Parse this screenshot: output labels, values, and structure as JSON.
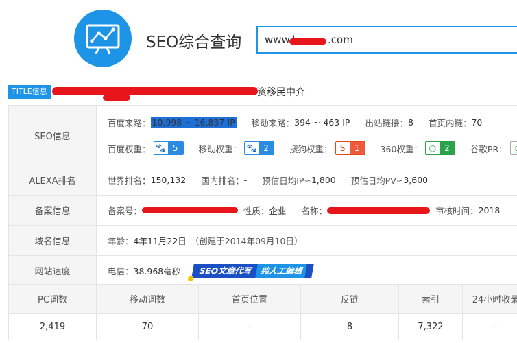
{
  "header": {
    "logo_icon": "chart-monitor-icon",
    "title": "SEO综合查询",
    "search_value": "www.l          .com"
  },
  "title_row": {
    "badge": "TITLE信息",
    "text_suffix": "资移民中介"
  },
  "seo": {
    "label": "SEO信息",
    "baidu_from_label": "百度来路：",
    "baidu_from_value": "10,998 ~ 16,837 IP",
    "mobile_from_label": "移动来路：",
    "mobile_from_value": "394 ~ 463 IP",
    "out_links_label": "出站链接：",
    "out_links_value": "8",
    "home_links_label": "首页内链：",
    "home_links_value": "70",
    "baidu_weight_label": "百度权重：",
    "baidu_weight_value": "5",
    "mobile_weight_label": "移动权重：",
    "mobile_weight_value": "2",
    "sogou_weight_label": "搜狗权重：",
    "sogou_weight_value": "1",
    "s360_weight_label": "360权重：",
    "s360_weight_value": "2",
    "google_pr_label": "谷歌PR："
  },
  "alexa": {
    "label": "ALEXA排名",
    "world_label": "世界排名：",
    "world_value": "150,132",
    "domestic_label": "国内排名：",
    "domestic_value": "-",
    "ip_label": "预估日均IP≈",
    "ip_value": "1,800",
    "pv_label": "预估日均PV≈",
    "pv_value": "3,600"
  },
  "icp": {
    "label": "备案信息",
    "number_label": "备案号：",
    "nature_label": "性质：",
    "nature_value": "企业",
    "name_label": "名称：",
    "review_label": "审核时间：",
    "review_value": "2018-"
  },
  "domain": {
    "label": "域名信息",
    "age_label": "年龄：",
    "age_value": "4年11月22日",
    "created_text": "（创建于2014年09月10日）"
  },
  "speed": {
    "label": "网站速度",
    "telecom_label": "电信：",
    "telecom_value": "38.968毫秒",
    "promo_1": "SEO文章代写",
    "promo_2": "纯人工编辑"
  },
  "stats": {
    "headers": [
      "PC词数",
      "移动词数",
      "首页位置",
      "反链",
      "索引",
      "24小时收录"
    ],
    "values": [
      "2,419",
      "70",
      "-",
      "8",
      "7,322",
      "-"
    ]
  },
  "colors": {
    "accent": "#1d94e6",
    "redaction": "#e8161b"
  }
}
